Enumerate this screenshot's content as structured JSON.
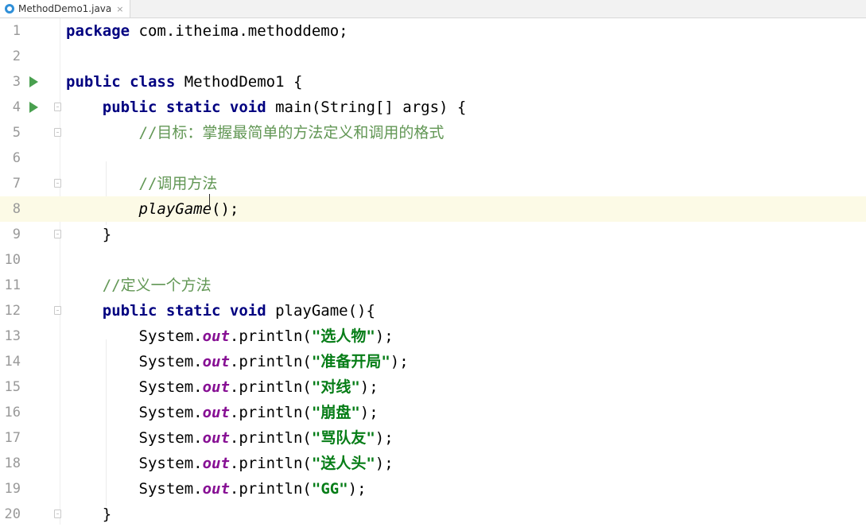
{
  "tab": {
    "filename": "MethodDemo1.java",
    "close": "×"
  },
  "colors": {
    "keyword": "#000080",
    "comment": "#629755",
    "string": "#067d17",
    "field": "#871094",
    "current_line": "#fcfae6",
    "run_icon": "#49a04f"
  },
  "icons": {
    "tab": "java-class-icon",
    "run": "run-arrow-icon",
    "fold": "fold-marker-icon"
  },
  "current_line": 8,
  "lines": [
    {
      "n": "1",
      "parts": [
        {
          "t": "package",
          "c": "kw"
        },
        {
          "t": " com.itheima.methoddemo;"
        }
      ]
    },
    {
      "n": "2",
      "parts": []
    },
    {
      "n": "3",
      "run": true,
      "parts": [
        {
          "t": "public class",
          "c": "kw"
        },
        {
          "t": " MethodDemo1 {"
        }
      ]
    },
    {
      "n": "4",
      "run": true,
      "fold": true,
      "parts": [
        {
          "t": "    "
        },
        {
          "t": "public static void",
          "c": "kw"
        },
        {
          "t": " main(String[] args) {"
        }
      ]
    },
    {
      "n": "5",
      "fold": true,
      "parts": [
        {
          "t": "        "
        },
        {
          "t": "//目标：掌握最简单的方法定义和调用的格式",
          "c": "cm"
        }
      ]
    },
    {
      "n": "6",
      "parts": []
    },
    {
      "n": "7",
      "fold": true,
      "parts": [
        {
          "t": "        "
        },
        {
          "t": "//调用方法",
          "c": "cm"
        }
      ]
    },
    {
      "n": "8",
      "parts": [
        {
          "t": "        "
        },
        {
          "t": "playGame",
          "c": "itl"
        },
        {
          "t": "();"
        }
      ]
    },
    {
      "n": "9",
      "fold": true,
      "parts": [
        {
          "t": "    }"
        }
      ]
    },
    {
      "n": "10",
      "parts": []
    },
    {
      "n": "11",
      "parts": [
        {
          "t": "    "
        },
        {
          "t": "//定义一个方法",
          "c": "cm"
        }
      ]
    },
    {
      "n": "12",
      "fold": true,
      "parts": [
        {
          "t": "    "
        },
        {
          "t": "public static void",
          "c": "kw"
        },
        {
          "t": " playGame(){"
        }
      ]
    },
    {
      "n": "13",
      "parts": [
        {
          "t": "        System."
        },
        {
          "t": "out",
          "c": "fld"
        },
        {
          "t": ".println("
        },
        {
          "t": "\"选人物\"",
          "c": "st"
        },
        {
          "t": ");"
        }
      ]
    },
    {
      "n": "14",
      "parts": [
        {
          "t": "        System."
        },
        {
          "t": "out",
          "c": "fld"
        },
        {
          "t": ".println("
        },
        {
          "t": "\"准备开局\"",
          "c": "st"
        },
        {
          "t": ");"
        }
      ]
    },
    {
      "n": "15",
      "parts": [
        {
          "t": "        System."
        },
        {
          "t": "out",
          "c": "fld"
        },
        {
          "t": ".println("
        },
        {
          "t": "\"对线\"",
          "c": "st"
        },
        {
          "t": ");"
        }
      ]
    },
    {
      "n": "16",
      "parts": [
        {
          "t": "        System."
        },
        {
          "t": "out",
          "c": "fld"
        },
        {
          "t": ".println("
        },
        {
          "t": "\"崩盘\"",
          "c": "st"
        },
        {
          "t": ");"
        }
      ]
    },
    {
      "n": "17",
      "parts": [
        {
          "t": "        System."
        },
        {
          "t": "out",
          "c": "fld"
        },
        {
          "t": ".println("
        },
        {
          "t": "\"骂队友\"",
          "c": "st"
        },
        {
          "t": ");"
        }
      ]
    },
    {
      "n": "18",
      "parts": [
        {
          "t": "        System."
        },
        {
          "t": "out",
          "c": "fld"
        },
        {
          "t": ".println("
        },
        {
          "t": "\"送人头\"",
          "c": "st"
        },
        {
          "t": ");"
        }
      ]
    },
    {
      "n": "19",
      "parts": [
        {
          "t": "        System."
        },
        {
          "t": "out",
          "c": "fld"
        },
        {
          "t": ".println("
        },
        {
          "t": "\"GG\"",
          "c": "st"
        },
        {
          "t": ");"
        }
      ]
    },
    {
      "n": "20",
      "fold": true,
      "parts": [
        {
          "t": "    }"
        }
      ]
    }
  ]
}
